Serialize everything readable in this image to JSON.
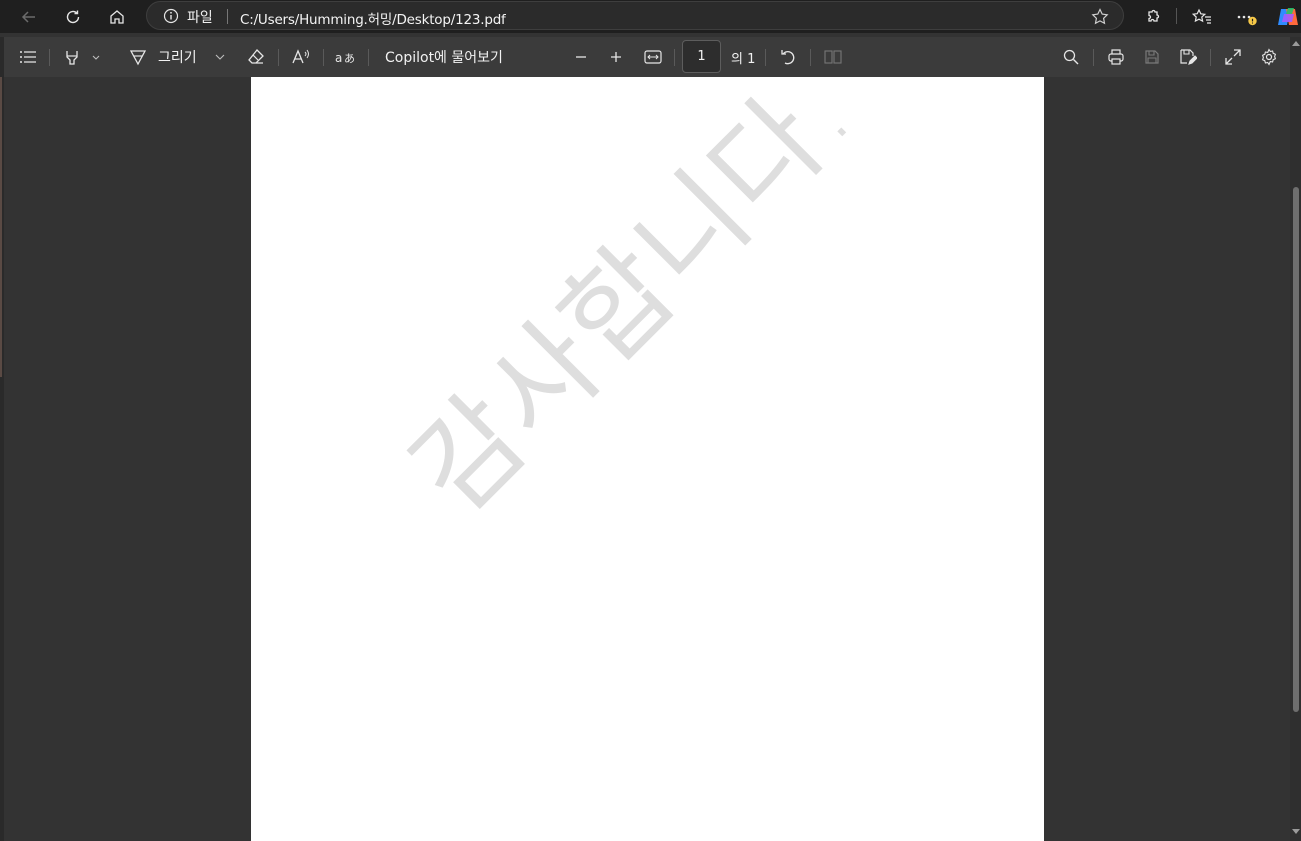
{
  "address_bar": {
    "scheme_label": "파일",
    "url": "C:/Users/Humming.허밍/Desktop/123.pdf"
  },
  "pdf_toolbar": {
    "draw_label": "그리기",
    "copilot_label": "Copilot에 물어보기",
    "page_number": "1",
    "page_total_label": "의 1"
  },
  "document": {
    "watermark_text": "감사합니다."
  },
  "icons": {
    "titlebar": [
      "back-icon",
      "refresh-icon",
      "home-icon",
      "info-icon",
      "star-icon",
      "extensions-icon",
      "favorites-icon",
      "more-icon",
      "copilot-icon"
    ],
    "toolbar": [
      "contents-icon",
      "highlight-icon",
      "draw-icon",
      "eraser-icon",
      "read-aloud-icon",
      "translate-icon",
      "zoom-out-icon",
      "zoom-in-icon",
      "fit-width-icon",
      "rotate-icon",
      "two-page-icon",
      "search-icon",
      "print-icon",
      "save-icon",
      "save-as-icon",
      "fullscreen-icon",
      "settings-icon"
    ]
  },
  "colors": {
    "titlebar_bg": "#1f1f1f",
    "toolbar_bg": "#3b3b3b",
    "viewer_bg": "#333333",
    "page_bg": "#ffffff",
    "watermark": "#dedede",
    "notification_badge": "#f7c948"
  }
}
